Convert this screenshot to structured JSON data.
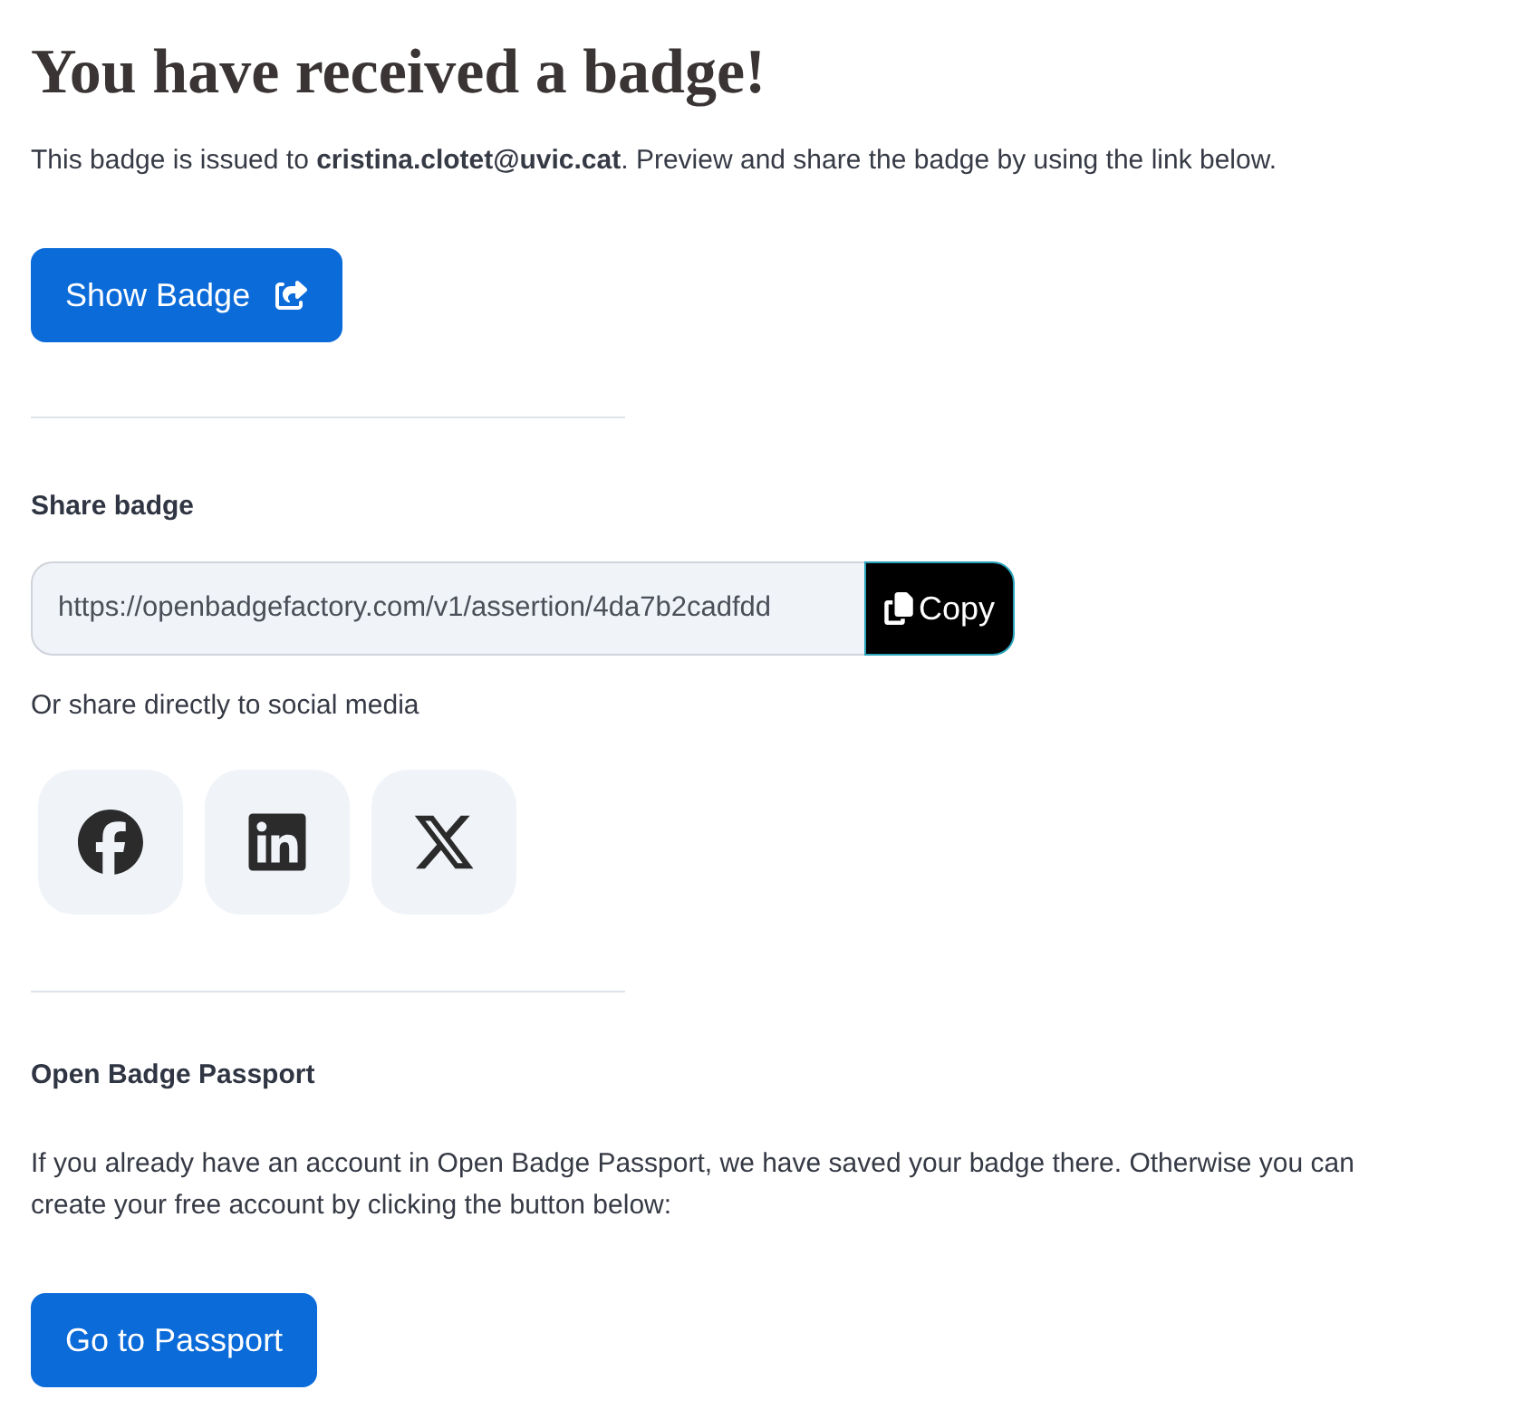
{
  "title": "You have received a badge!",
  "intro": "This badge is issued to **cristina.clotet@uvic.cat**. Preview and share the badge by using the link below.",
  "show_badge_button": {
    "label": "Show Badge"
  },
  "share": {
    "heading": "Share badge",
    "link_field": {
      "value": "https://openbadgefactory.com/v1/assertion/4da7b2cadfdd"
    },
    "copy_button": {
      "label": "Copy"
    },
    "social_label": "Or share directly to social media",
    "social_buttons": [
      {
        "kind": "facebook"
      },
      {
        "kind": "linkedin"
      },
      {
        "kind": "x"
      }
    ]
  },
  "passport": {
    "heading": "Open Badge Passport",
    "text": "If you already have an account in Open Badge Passport, we have saved your badge there. Otherwise you can create your free account by clicking the button below:",
    "button": {
      "label": "Go to Passport"
    }
  }
}
